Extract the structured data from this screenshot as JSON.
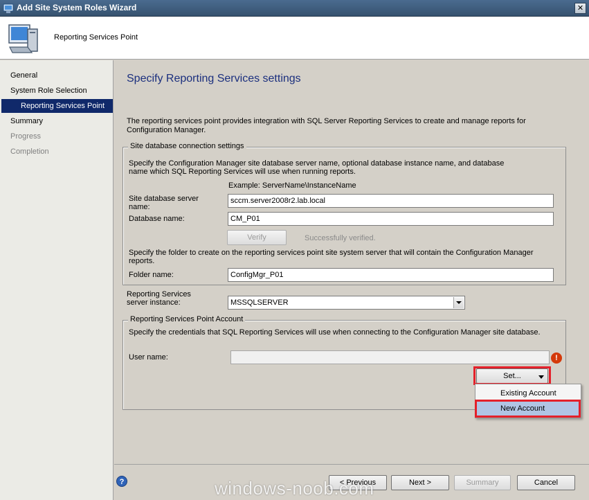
{
  "window": {
    "title": "Add Site System Roles Wizard",
    "close_glyph": "✕"
  },
  "header": {
    "title": "Reporting Services Point"
  },
  "nav": {
    "items": [
      {
        "label": "General"
      },
      {
        "label": "System Role Selection"
      },
      {
        "label": "Reporting Services Point"
      },
      {
        "label": "Summary"
      },
      {
        "label": "Progress"
      },
      {
        "label": "Completion"
      }
    ]
  },
  "page": {
    "title": "Specify Reporting Services settings",
    "intro": "The reporting services point provides integration with SQL Server Reporting Services to create and manage reports for Configuration Manager."
  },
  "db_group": {
    "legend": "Site database connection settings",
    "description": "Specify the Configuration Manager site database server name, optional database instance name, and database name which SQL Reporting Services will use when running reports.",
    "example": "Example: ServerName\\InstanceName",
    "server_label": "Site database server name:",
    "server_value": "sccm.server2008r2.lab.local",
    "db_label": "Database name:",
    "db_value": "CM_P01",
    "verify_label": "Verify",
    "verify_status": "Successfully verified.",
    "folder_desc": "Specify the folder to create on the reporting services point site system server that will contain the Configuration Manager reports.",
    "folder_label": "Folder name:",
    "folder_value": "ConfigMgr_P01"
  },
  "instance": {
    "label": "Reporting Services server instance:",
    "value": "MSSQLSERVER"
  },
  "account_group": {
    "legend": "Reporting Services Point Account",
    "description": "Specify the credentials that SQL Reporting Services will use when connecting to the Configuration Manager site database.",
    "user_label": "User name:",
    "user_value": "",
    "set_label": "Set...",
    "menu": [
      {
        "label": "Existing Account"
      },
      {
        "label": "New Account"
      }
    ]
  },
  "buttons": {
    "previous": "< Previous",
    "next": "Next >",
    "summary": "Summary",
    "cancel": "Cancel",
    "help": "?"
  },
  "watermark": "windows-noob.com",
  "colors": {
    "highlight": "#e4202a",
    "nav_active": "#10296a",
    "title_blue": "#1b2f7e"
  }
}
